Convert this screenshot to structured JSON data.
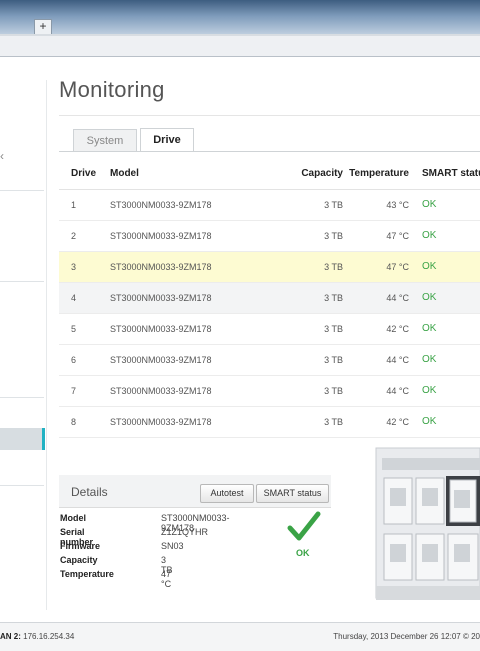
{
  "browser": {
    "new_tab_label": "+"
  },
  "page": {
    "title": "Monitoring"
  },
  "tabs": [
    {
      "label": "System",
      "active": false
    },
    {
      "label": "Drive",
      "active": true
    }
  ],
  "table": {
    "headers": {
      "drive": "Drive",
      "model": "Model",
      "capacity": "Capacity",
      "temperature": "Temperature",
      "smart": "SMART status"
    },
    "rows": [
      {
        "drive": "1",
        "model": "ST3000NM0033-9ZM178",
        "capacity": "3 TB",
        "temperature": "43 °C",
        "smart": "OK"
      },
      {
        "drive": "2",
        "model": "ST3000NM0033-9ZM178",
        "capacity": "3 TB",
        "temperature": "47 °C",
        "smart": "OK"
      },
      {
        "drive": "3",
        "model": "ST3000NM0033-9ZM178",
        "capacity": "3 TB",
        "temperature": "47 °C",
        "smart": "OK"
      },
      {
        "drive": "4",
        "model": "ST3000NM0033-9ZM178",
        "capacity": "3 TB",
        "temperature": "44 °C",
        "smart": "OK"
      },
      {
        "drive": "5",
        "model": "ST3000NM0033-9ZM178",
        "capacity": "3 TB",
        "temperature": "42 °C",
        "smart": "OK"
      },
      {
        "drive": "6",
        "model": "ST3000NM0033-9ZM178",
        "capacity": "3 TB",
        "temperature": "44 °C",
        "smart": "OK"
      },
      {
        "drive": "7",
        "model": "ST3000NM0033-9ZM178",
        "capacity": "3 TB",
        "temperature": "44 °C",
        "smart": "OK"
      },
      {
        "drive": "8",
        "model": "ST3000NM0033-9ZM178",
        "capacity": "3 TB",
        "temperature": "42 °C",
        "smart": "OK"
      }
    ],
    "selected_drive": "3"
  },
  "details": {
    "label": "Details",
    "autotest_label": "Autotest",
    "smart_label": "SMART status",
    "fields": {
      "model_key": "Model",
      "model_val": "ST3000NM0033-9ZM178",
      "serial_key": "Serial number",
      "serial_val": "Z1Z1QYHR",
      "firmware_key": "Firmware",
      "firmware_val": "SN03",
      "capacity_key": "Capacity",
      "capacity_val": "3 TB",
      "temp_key": "Temperature",
      "temp_val": "47 °C"
    },
    "status": "OK"
  },
  "statusbar": {
    "lan_label": "AN 2:",
    "lan_ip": "176.16.254.34",
    "datetime": "Thursday, 2013 December 26   12:07   © 20"
  },
  "colors": {
    "accent": "#21b2c3",
    "ok": "#3aa346",
    "highlight_row": "#fdfbd2"
  }
}
